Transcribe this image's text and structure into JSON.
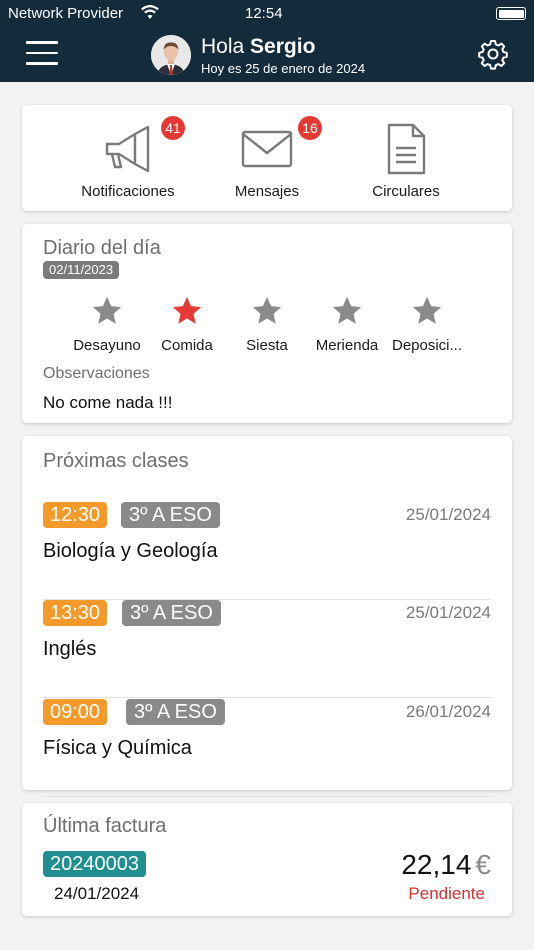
{
  "status_bar": {
    "carrier": "Network Provider",
    "time": "12:54"
  },
  "header": {
    "greeting_prefix": "Hola",
    "user_name": "Sergio",
    "subtitle": "Hoy es 25 de enero de 2024"
  },
  "shortcuts": [
    {
      "label": "Notificaciones",
      "badge": "41",
      "icon": "megaphone-icon"
    },
    {
      "label": "Mensajes",
      "badge": "16",
      "icon": "envelope-icon"
    },
    {
      "label": "Circulares",
      "badge": "",
      "icon": "document-icon"
    }
  ],
  "diary": {
    "title": "Diario del día",
    "date": "02/11/2023",
    "meals": [
      {
        "label": "Desayuno",
        "active": false
      },
      {
        "label": "Comida",
        "active": true
      },
      {
        "label": "Siesta",
        "active": false
      },
      {
        "label": "Merienda",
        "active": false
      },
      {
        "label": "Deposici...",
        "active": false
      }
    ],
    "observations_label": "Observaciones",
    "observations": "No come nada !!!"
  },
  "classes": {
    "title": "Próximas clases",
    "items": [
      {
        "time": "12:30",
        "group": "3º A ESO",
        "date": "25/01/2024",
        "subject": "Biología y Geología"
      },
      {
        "time": "13:30",
        "group": "3º A ESO",
        "date": "25/01/2024",
        "subject": "Inglés"
      },
      {
        "time": "09:00",
        "group": "3º A ESO",
        "date": "26/01/2024",
        "subject": "Física y Química"
      }
    ]
  },
  "invoice": {
    "title": "Última factura",
    "number": "20240003",
    "date": "24/01/2024",
    "amount": "22,14",
    "currency": "€",
    "status": "Pendiente"
  },
  "colors": {
    "header_bg": "#132b3a",
    "badge": "#e53935",
    "time_chip": "#f39a2b",
    "group_chip": "#8a8a8a",
    "invoice_chip": "#1f8f91",
    "status_pending": "#d32f2f",
    "star_active": "#e53935",
    "star_inactive": "#8a8a8a"
  }
}
